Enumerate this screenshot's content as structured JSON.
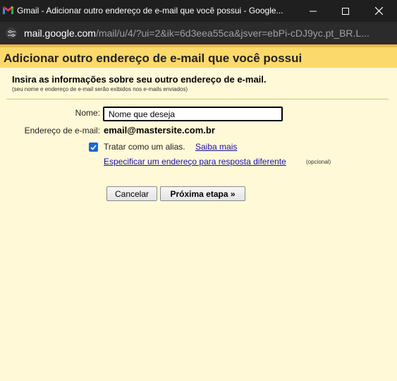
{
  "window": {
    "title": "Gmail - Adicionar outro endereço de e-mail que você possui - Google...",
    "icons": {
      "logo": "gmail-logo",
      "minimize": "minimize-icon",
      "maximize": "maximize-icon",
      "close": "close-icon"
    }
  },
  "address_bar": {
    "url_domain": "mail.google.com",
    "url_path": "/mail/u/4/?ui=2&ik=6d3eea55ca&jsver=ebPi-cDJ9yc.pt_BR.L...",
    "site_info_icon": "tune-icon"
  },
  "page": {
    "title": "Adicionar outro endereço de e-mail que você possui",
    "intro_heading": "Insira as informações sobre seu outro endereço de e-mail.",
    "intro_sub": "(seu nome e endereço de e-mail serão exibidos nos e-mails enviados)"
  },
  "form": {
    "name_label": "Nome:",
    "name_value": "Nome que deseja",
    "email_label": "Endereço de e-mail:",
    "email_value": "email@mastersite.com.br",
    "alias_checked": true,
    "alias_label": "Tratar como um alias.",
    "learn_more": "Saiba mais",
    "reply_link": "Especificar um endereço para resposta diferente",
    "optional": "(opcional)"
  },
  "buttons": {
    "cancel": "Cancelar",
    "next": "Próxima etapa »"
  },
  "colors": {
    "page_background": "#fff9d7",
    "header_background": "#fbd96b",
    "link": "#1a0dab",
    "checkbox": "#1a66d2"
  }
}
